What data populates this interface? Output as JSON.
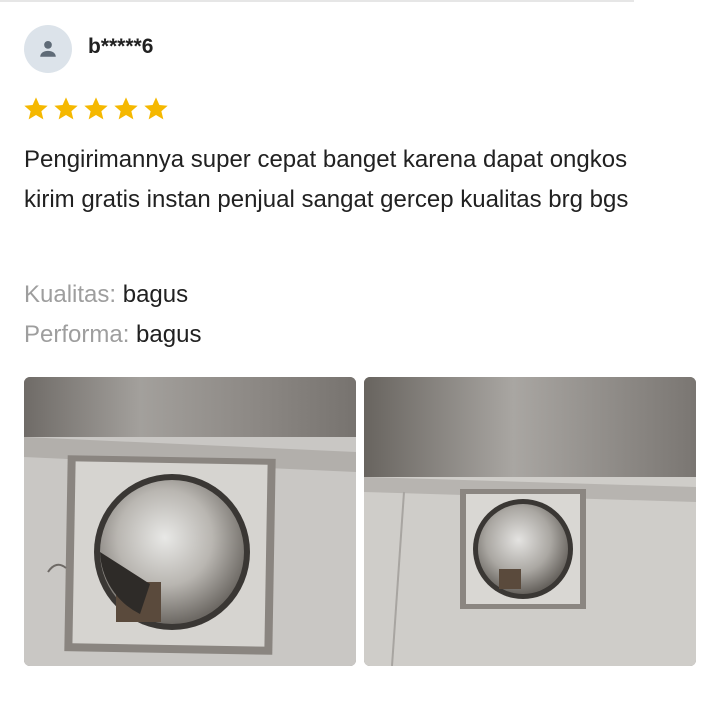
{
  "review": {
    "username": "b*****6",
    "rating": 5,
    "text": "Pengirimannya super cepat banget karena dapat ongkos kirim gratis instan penjual sangat gercep kualitas brg bgs",
    "attributes": [
      {
        "label": "Kualitas:",
        "value": "bagus"
      },
      {
        "label": "Performa:",
        "value": "bagus"
      }
    ]
  },
  "icons": {
    "avatar": "person-icon",
    "star": "star-icon"
  },
  "colors": {
    "star": "#f5b800",
    "avatar_bg": "#dce3ea",
    "avatar_icon": "#5f6b77",
    "label": "#9e9e9e"
  }
}
